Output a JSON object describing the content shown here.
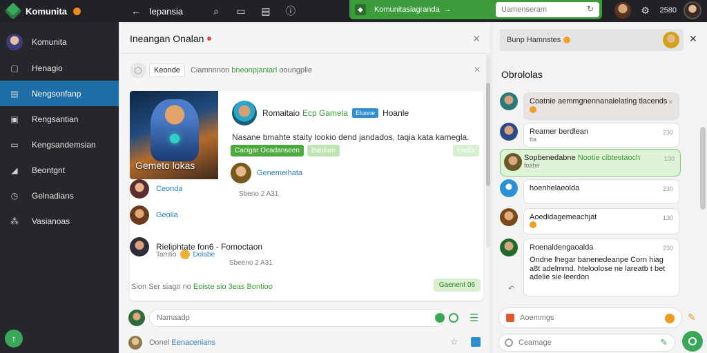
{
  "app": {
    "name": "Komunita"
  },
  "topbar": {
    "title": "Iepansia",
    "channel_label": "Komunitasiagranda",
    "channel_arrow": "→",
    "search_placeholder": "Uamenseram",
    "count": "2580"
  },
  "sidebar": {
    "profile_label": "Komunita",
    "items": [
      {
        "label": "Henagio",
        "icon": "chat-icon"
      },
      {
        "label": "Nengsonfanp",
        "icon": "list-icon",
        "active": true
      },
      {
        "label": "Rengsantian",
        "icon": "document-icon"
      },
      {
        "label": "Kengsandemsian",
        "icon": "monitor-icon"
      },
      {
        "label": "Beontgnt",
        "icon": "pen-icon"
      },
      {
        "label": "Gelnadians",
        "icon": "clock-icon"
      },
      {
        "label": "Vasianoas",
        "icon": "group-icon"
      }
    ],
    "fab_label": "↑"
  },
  "center": {
    "title": "Ineangan Onalan",
    "filter": {
      "chip": "Keonde",
      "text_prefix": "Ciamnnnon",
      "text_highlight": "bneonpjaniarl",
      "text_suffix": "ooungplie"
    },
    "post": {
      "art_label": "Gemeto lokas",
      "author": "Romaitaio",
      "author_green": "Ecp Gamela",
      "badge": "Eluone",
      "role": "Hoanle",
      "body": "Nasane bmahte staity lookio dend jandados, taqia kata kamegla.",
      "tag1": "Cacigar Ocadanseen",
      "tag2": "Bardam",
      "tag_right": "Fartta",
      "comment_link": "Genemeihata",
      "comment_time": "Sbeno 2 A31",
      "replies": [
        {
          "label": "Ceonda"
        },
        {
          "label": "Geolia"
        }
      ],
      "reply3_name": "Rieliphtate fon6 - Fomoctaon",
      "reply3_sub": "Tamtio",
      "reply3_link": "Doiabe",
      "reply3_time": "Sbeeno 2 A31",
      "stats_prefix": "Sion Ser siago no",
      "stats_green": "Eoiste sio 3eas Bontioo",
      "stat_button": "Gaenent 06"
    },
    "composer_placeholder": "Namaadp",
    "bottom_text_prefix": "Oonel",
    "bottom_text_blue": "Eenacenians"
  },
  "right": {
    "header": "Bunp Hamnstes",
    "title": "Obrololas",
    "messages": [
      {
        "text": "Coatnie aemmgnennanalelating tlacends",
        "time": "",
        "style": "grey"
      },
      {
        "text": "Reamer berdlean",
        "sub": "tta",
        "time": "230"
      },
      {
        "text": "Sopbenedabne",
        "green": "Nootie cibtestaoch",
        "sub": "foahe",
        "time": "130",
        "style": "green"
      },
      {
        "text": "hoenhelaeolda",
        "time": "230"
      },
      {
        "text": "Aoedidagemeachjat",
        "time": "130"
      },
      {
        "text": "Roenaldengaoalda",
        "time": "230",
        "body": "Ondne lhegar banenedeanpe Corn hiag a8t adelmmd. hteloolose ne lareatb t bet adelie sie leerdon"
      }
    ],
    "input1_placeholder": "Aoemmgs",
    "input2_placeholder": "Ceamage"
  },
  "colors": {
    "accent_green": "#3aa65a",
    "active_blue": "#1f6ea8",
    "sidebar_bg": "#25272a"
  }
}
